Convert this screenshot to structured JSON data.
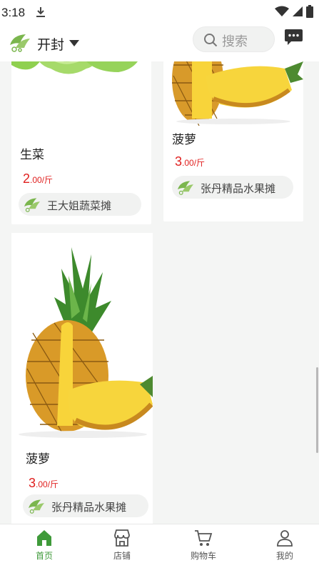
{
  "status_bar": {
    "time": "3:18"
  },
  "header": {
    "city": "开封",
    "search_placeholder": "搜索"
  },
  "products": [
    {
      "name": "生菜",
      "price_int": "2",
      "price_unit": ".00/斤",
      "shop": "王大姐蔬菜摊"
    },
    {
      "name": "菠萝",
      "price_int": "3",
      "price_unit": ".00/斤",
      "shop": "张丹精品水果摊"
    },
    {
      "name": "菠萝",
      "price_int": "3",
      "price_unit": ".00/斤",
      "shop": "张丹精品水果摊"
    }
  ],
  "tabs": [
    {
      "label": "首页",
      "icon": "home-icon",
      "active": true
    },
    {
      "label": "店铺",
      "icon": "store-icon",
      "active": false
    },
    {
      "label": "购物车",
      "icon": "cart-icon",
      "active": false
    },
    {
      "label": "我的",
      "icon": "user-icon",
      "active": false
    }
  ],
  "colors": {
    "accent": "#3f9a3a",
    "price": "#e0201f",
    "background": "#f4f5f4"
  }
}
